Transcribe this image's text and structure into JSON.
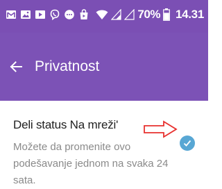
{
  "status_bar": {
    "battery": "70%",
    "time": "14.31",
    "notification_icons": [
      "mail-icon",
      "gallery-icon",
      "play-store-icon",
      "viber-icon",
      "messenger-icon",
      "shopping-bag-icon"
    ]
  },
  "app_bar": {
    "title": "Privatnost",
    "back_icon": "arrow-left-icon"
  },
  "settings": [
    {
      "title": "Deli status Na mreži'",
      "summary": "Možete da promenite ovo podešavanje jednom na svaka 24 sata.",
      "checked": true
    }
  ],
  "colors": {
    "status_bar": "#7b4fb4",
    "app_bar": "#7c52b6",
    "check": "#58a7d4",
    "annotation_arrow": "#e8312f"
  }
}
